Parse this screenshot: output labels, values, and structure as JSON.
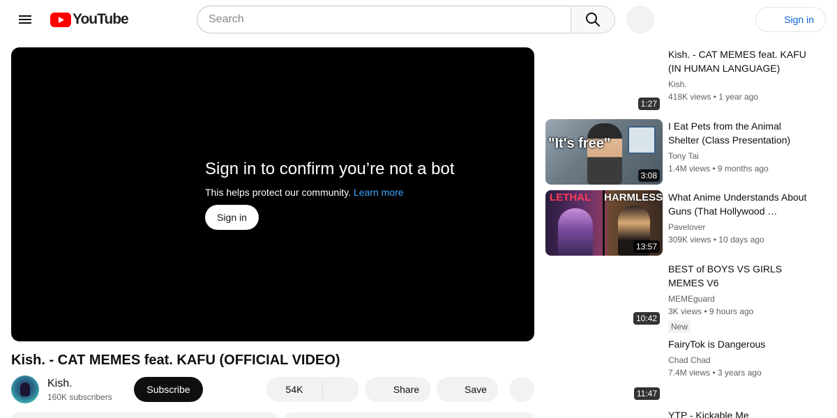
{
  "header": {
    "logo_text": "YouTube",
    "search_placeholder": "Search",
    "signin_label": "Sign in"
  },
  "player": {
    "bot_title": "Sign in to confirm you’re not a bot",
    "bot_subtitle": "This helps protect our community.",
    "learn_more": "Learn more",
    "signin_label": "Sign in"
  },
  "video": {
    "title": "Kish. - CAT MEMES feat. KAFU (OFFICIAL VIDEO)",
    "channel_name": "Kish.",
    "subscribers": "160K subscribers",
    "subscribe_label": "Subscribe",
    "likes": "54K",
    "share_label": "Share",
    "save_label": "Save"
  },
  "recommendations": [
    {
      "title": "Kish. - CAT MEMES feat. KAFU (IN HUMAN LANGUAGE)",
      "channel": "Kish.",
      "views": "418K views",
      "age": "1 year ago",
      "duration": "1:27",
      "badge": ""
    },
    {
      "title": "I Eat Pets from the Animal Shelter (Class Presentation)",
      "channel": "Tony Tai",
      "views": "1.4M views",
      "age": "9 months ago",
      "duration": "3:08",
      "badge": "",
      "thumb_text": "\"It's free\""
    },
    {
      "title": "What Anime Understands About Guns (That Hollywood …",
      "channel": "Pavelover",
      "views": "309K views",
      "age": "10 days ago",
      "duration": "13:57",
      "badge": "",
      "thumb_text_left": "LETHAL",
      "thumb_text_right": "HARMLESS"
    },
    {
      "title": "BEST of BOYS VS GIRLS MEMES V6",
      "channel": "MEMEguard",
      "views": "3K views",
      "age": "9 hours ago",
      "duration": "10:42",
      "badge": "New"
    },
    {
      "title": "FairyTok is Dangerous",
      "channel": "Chad Chad",
      "views": "7.4M views",
      "age": "3 years ago",
      "duration": "11:47",
      "badge": ""
    },
    {
      "title": "YTP - Kickable Me",
      "channel": "",
      "views": "",
      "age": "",
      "duration": "",
      "badge": ""
    }
  ],
  "meta_separator": "•",
  "colors": {
    "brand_red": "#ff0000",
    "link_blue": "#065fd4",
    "player_link_blue": "#3ea6ff"
  }
}
